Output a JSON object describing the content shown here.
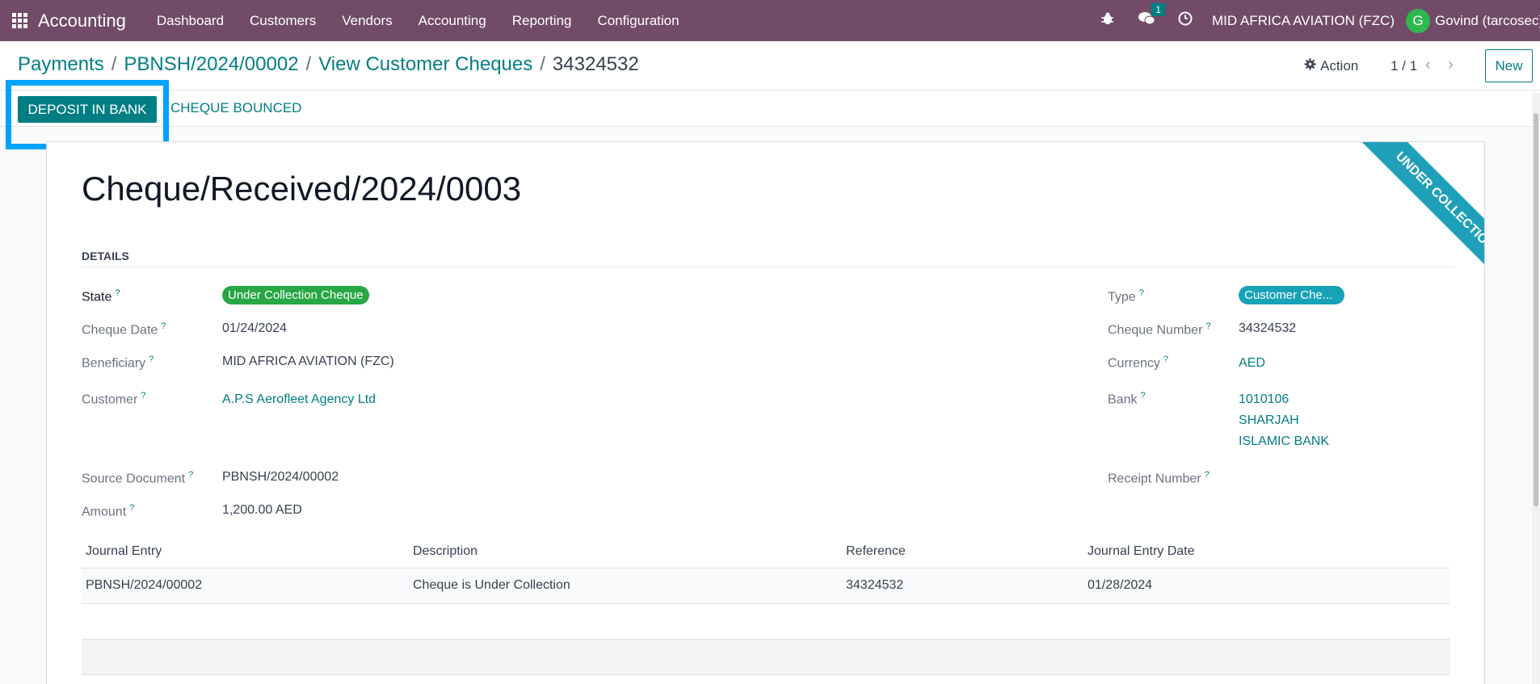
{
  "navbar": {
    "app_name": "Accounting",
    "menu": [
      "Dashboard",
      "Customers",
      "Vendors",
      "Accounting",
      "Reporting",
      "Configuration"
    ],
    "messages_count": "1",
    "company": "MID AFRICA AVIATION (FZC)",
    "avatar_initial": "G",
    "user": "Govind (tarcosec)"
  },
  "breadcrumb": {
    "items": [
      "Payments",
      "PBNSH/2024/00002",
      "View Customer Cheques"
    ],
    "current": "34324532"
  },
  "control": {
    "action_label": "Action",
    "pager": "1 / 1",
    "new_label": "New"
  },
  "statusbar": {
    "deposit_label": "DEPOSIT IN BANK",
    "bounced_label": "CHEQUE BOUNCED"
  },
  "form": {
    "ribbon": "Under Collection",
    "title": "Cheque/Received/2024/0003",
    "section": "DETAILS",
    "left": {
      "state_label": "State",
      "state_value": "Under Collection Cheque",
      "cheque_date_label": "Cheque Date",
      "cheque_date_value": "01/24/2024",
      "beneficiary_label": "Beneficiary",
      "beneficiary_value": "MID AFRICA AVIATION (FZC)",
      "customer_label": "Customer",
      "customer_value": "A.P.S Aerofleet Agency Ltd",
      "source_label": "Source Document",
      "source_value": "PBNSH/2024/00002",
      "amount_label": "Amount",
      "amount_value": "1,200.00 AED"
    },
    "right": {
      "type_label": "Type",
      "type_value": "Customer Che...",
      "cheque_number_label": "Cheque Number",
      "cheque_number_value": "34324532",
      "currency_label": "Currency",
      "currency_value": "AED",
      "bank_label": "Bank",
      "bank_lines": [
        "1010106",
        "SHARJAH",
        "ISLAMIC BANK"
      ],
      "receipt_label": "Receipt Number"
    },
    "table": {
      "headers": [
        "Journal Entry",
        "Description",
        "Reference",
        "Journal Entry Date"
      ],
      "rows": [
        [
          "PBNSH/2024/00002",
          "Cheque is Under Collection",
          "34324532",
          "01/28/2024"
        ]
      ]
    }
  },
  "colors": {
    "navbar": "#714b67",
    "primary": "#017e84",
    "highlight": "#00a2ff",
    "ribbon": "#1fa0b8",
    "state_pill": "#28a745",
    "type_pill": "#17a2b8"
  }
}
